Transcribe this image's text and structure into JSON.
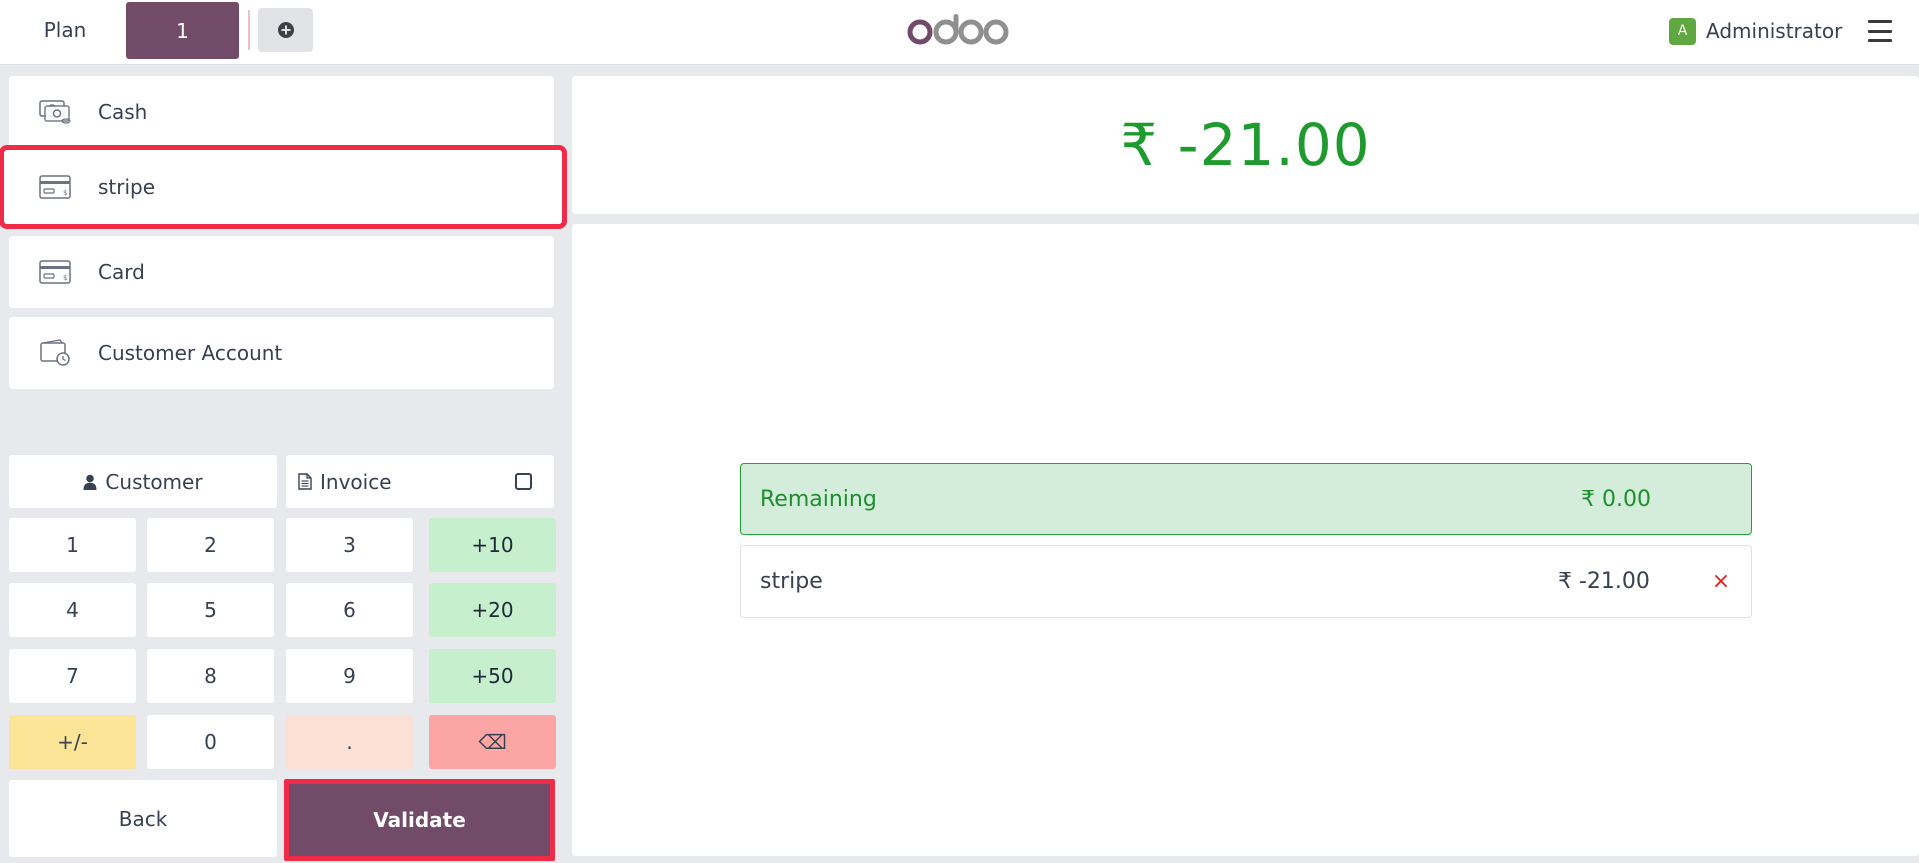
{
  "header": {
    "plan_label": "Plan",
    "order_tab": "1",
    "add_order_icon": "plus-circle-icon",
    "logo_text": "odoo",
    "user_initial": "A",
    "user_name": "Administrator",
    "menu_icon": "hamburger-icon"
  },
  "payment_methods": [
    {
      "label": "Cash",
      "icon": "cash-icon"
    },
    {
      "label": "stripe",
      "icon": "card-icon",
      "highlighted": true
    },
    {
      "label": "Card",
      "icon": "card-icon"
    },
    {
      "label": "Customer Account",
      "icon": "wallet-clock-icon"
    }
  ],
  "options": {
    "customer_label": "Customer",
    "invoice_label": "Invoice",
    "invoice_checked": false
  },
  "numpad": {
    "rows": [
      [
        "1",
        "2",
        "3",
        "+10"
      ],
      [
        "4",
        "5",
        "6",
        "+20"
      ],
      [
        "7",
        "8",
        "9",
        "+50"
      ],
      [
        "+/-",
        "0",
        ".",
        "⌫"
      ]
    ]
  },
  "actions": {
    "back_label": "Back",
    "validate_label": "Validate"
  },
  "summary": {
    "total": "₹ -21.00",
    "remaining_label": "Remaining",
    "remaining_value": "₹ 0.00",
    "lines": [
      {
        "method": "stripe",
        "amount": "₹ -21.00",
        "delete_icon": "×"
      }
    ]
  },
  "colors": {
    "brand": "#714b67",
    "highlight": "#ef2b48",
    "positive": "#1e9a2f"
  }
}
